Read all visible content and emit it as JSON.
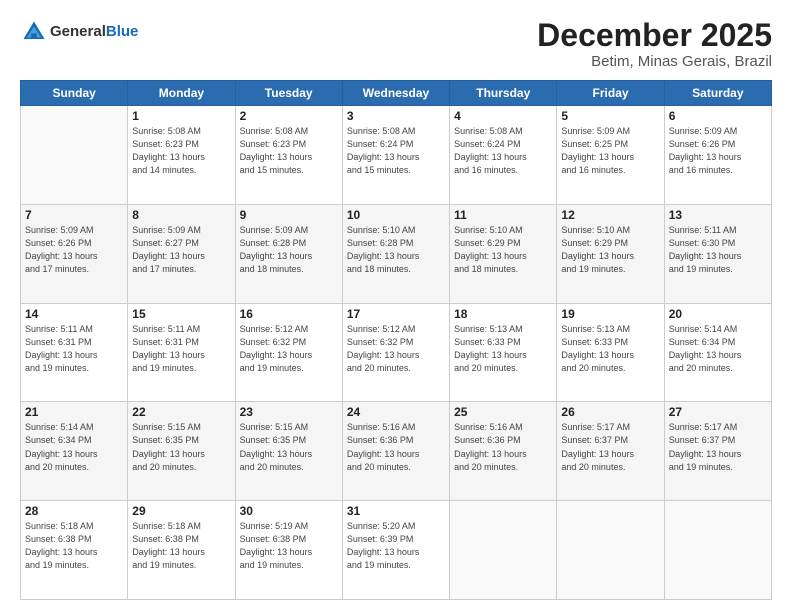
{
  "logo": {
    "general": "General",
    "blue": "Blue"
  },
  "header": {
    "month": "December 2025",
    "location": "Betim, Minas Gerais, Brazil"
  },
  "weekdays": [
    "Sunday",
    "Monday",
    "Tuesday",
    "Wednesday",
    "Thursday",
    "Friday",
    "Saturday"
  ],
  "weeks": [
    [
      {
        "day": "",
        "info": ""
      },
      {
        "day": "1",
        "info": "Sunrise: 5:08 AM\nSunset: 6:23 PM\nDaylight: 13 hours\nand 14 minutes."
      },
      {
        "day": "2",
        "info": "Sunrise: 5:08 AM\nSunset: 6:23 PM\nDaylight: 13 hours\nand 15 minutes."
      },
      {
        "day": "3",
        "info": "Sunrise: 5:08 AM\nSunset: 6:24 PM\nDaylight: 13 hours\nand 15 minutes."
      },
      {
        "day": "4",
        "info": "Sunrise: 5:08 AM\nSunset: 6:24 PM\nDaylight: 13 hours\nand 16 minutes."
      },
      {
        "day": "5",
        "info": "Sunrise: 5:09 AM\nSunset: 6:25 PM\nDaylight: 13 hours\nand 16 minutes."
      },
      {
        "day": "6",
        "info": "Sunrise: 5:09 AM\nSunset: 6:26 PM\nDaylight: 13 hours\nand 16 minutes."
      }
    ],
    [
      {
        "day": "7",
        "info": "Sunrise: 5:09 AM\nSunset: 6:26 PM\nDaylight: 13 hours\nand 17 minutes."
      },
      {
        "day": "8",
        "info": "Sunrise: 5:09 AM\nSunset: 6:27 PM\nDaylight: 13 hours\nand 17 minutes."
      },
      {
        "day": "9",
        "info": "Sunrise: 5:09 AM\nSunset: 6:28 PM\nDaylight: 13 hours\nand 18 minutes."
      },
      {
        "day": "10",
        "info": "Sunrise: 5:10 AM\nSunset: 6:28 PM\nDaylight: 13 hours\nand 18 minutes."
      },
      {
        "day": "11",
        "info": "Sunrise: 5:10 AM\nSunset: 6:29 PM\nDaylight: 13 hours\nand 18 minutes."
      },
      {
        "day": "12",
        "info": "Sunrise: 5:10 AM\nSunset: 6:29 PM\nDaylight: 13 hours\nand 19 minutes."
      },
      {
        "day": "13",
        "info": "Sunrise: 5:11 AM\nSunset: 6:30 PM\nDaylight: 13 hours\nand 19 minutes."
      }
    ],
    [
      {
        "day": "14",
        "info": "Sunrise: 5:11 AM\nSunset: 6:31 PM\nDaylight: 13 hours\nand 19 minutes."
      },
      {
        "day": "15",
        "info": "Sunrise: 5:11 AM\nSunset: 6:31 PM\nDaylight: 13 hours\nand 19 minutes."
      },
      {
        "day": "16",
        "info": "Sunrise: 5:12 AM\nSunset: 6:32 PM\nDaylight: 13 hours\nand 19 minutes."
      },
      {
        "day": "17",
        "info": "Sunrise: 5:12 AM\nSunset: 6:32 PM\nDaylight: 13 hours\nand 20 minutes."
      },
      {
        "day": "18",
        "info": "Sunrise: 5:13 AM\nSunset: 6:33 PM\nDaylight: 13 hours\nand 20 minutes."
      },
      {
        "day": "19",
        "info": "Sunrise: 5:13 AM\nSunset: 6:33 PM\nDaylight: 13 hours\nand 20 minutes."
      },
      {
        "day": "20",
        "info": "Sunrise: 5:14 AM\nSunset: 6:34 PM\nDaylight: 13 hours\nand 20 minutes."
      }
    ],
    [
      {
        "day": "21",
        "info": "Sunrise: 5:14 AM\nSunset: 6:34 PM\nDaylight: 13 hours\nand 20 minutes."
      },
      {
        "day": "22",
        "info": "Sunrise: 5:15 AM\nSunset: 6:35 PM\nDaylight: 13 hours\nand 20 minutes."
      },
      {
        "day": "23",
        "info": "Sunrise: 5:15 AM\nSunset: 6:35 PM\nDaylight: 13 hours\nand 20 minutes."
      },
      {
        "day": "24",
        "info": "Sunrise: 5:16 AM\nSunset: 6:36 PM\nDaylight: 13 hours\nand 20 minutes."
      },
      {
        "day": "25",
        "info": "Sunrise: 5:16 AM\nSunset: 6:36 PM\nDaylight: 13 hours\nand 20 minutes."
      },
      {
        "day": "26",
        "info": "Sunrise: 5:17 AM\nSunset: 6:37 PM\nDaylight: 13 hours\nand 20 minutes."
      },
      {
        "day": "27",
        "info": "Sunrise: 5:17 AM\nSunset: 6:37 PM\nDaylight: 13 hours\nand 19 minutes."
      }
    ],
    [
      {
        "day": "28",
        "info": "Sunrise: 5:18 AM\nSunset: 6:38 PM\nDaylight: 13 hours\nand 19 minutes."
      },
      {
        "day": "29",
        "info": "Sunrise: 5:18 AM\nSunset: 6:38 PM\nDaylight: 13 hours\nand 19 minutes."
      },
      {
        "day": "30",
        "info": "Sunrise: 5:19 AM\nSunset: 6:38 PM\nDaylight: 13 hours\nand 19 minutes."
      },
      {
        "day": "31",
        "info": "Sunrise: 5:20 AM\nSunset: 6:39 PM\nDaylight: 13 hours\nand 19 minutes."
      },
      {
        "day": "",
        "info": ""
      },
      {
        "day": "",
        "info": ""
      },
      {
        "day": "",
        "info": ""
      }
    ]
  ]
}
